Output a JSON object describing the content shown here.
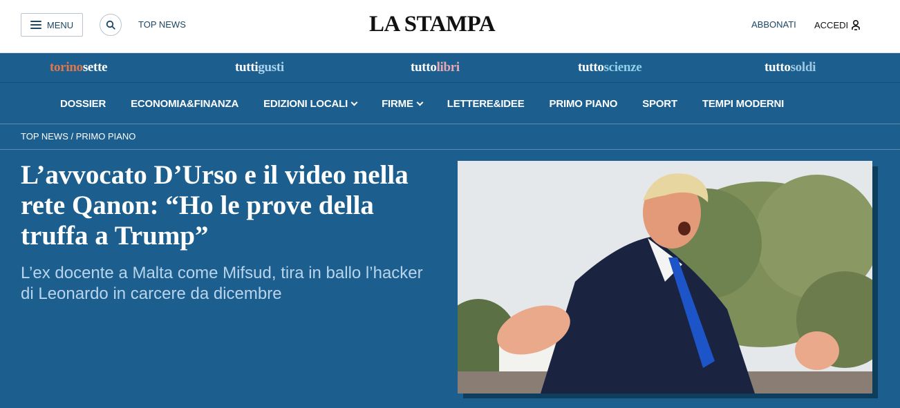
{
  "header": {
    "menu_label": "MENU",
    "top_news_link": "TOP NEWS",
    "logo": "LA STAMPA",
    "subscribe_label": "ABBONATI",
    "login_label": "ACCEDI",
    "icons": [
      "hamburger-icon",
      "search-icon",
      "user-icon"
    ]
  },
  "supplements": [
    {
      "part1": "torino",
      "part2": "sette",
      "color1": "#e0774c",
      "color2": "#ffffff"
    },
    {
      "part1": "tutti",
      "part2": "gusti",
      "color1": "#ffffff",
      "color2": "#a9d3ee"
    },
    {
      "part1": "tutto",
      "part2": "libri",
      "color1": "#ffffff",
      "color2": "#e7a7b3"
    },
    {
      "part1": "tutto",
      "part2": "scienze",
      "color1": "#ffffff",
      "color2": "#8fd0e8"
    },
    {
      "part1": "tutto",
      "part2": "soldi",
      "color1": "#ffffff",
      "color2": "#9cc8e4"
    }
  ],
  "nav": {
    "items": [
      {
        "label": "DOSSIER",
        "dropdown": false
      },
      {
        "label": "ECONOMIA&FINANZA",
        "dropdown": false
      },
      {
        "label": "EDIZIONI LOCALI",
        "dropdown": true
      },
      {
        "label": "FIRME",
        "dropdown": true
      },
      {
        "label": "LETTERE&IDEE",
        "dropdown": false
      },
      {
        "label": "PRIMO PIANO",
        "dropdown": false
      },
      {
        "label": "SPORT",
        "dropdown": false
      },
      {
        "label": "TEMPI MODERNI",
        "dropdown": false
      }
    ]
  },
  "breadcrumb": {
    "section": "TOP NEWS",
    "separator": " / ",
    "subsection": "PRIMO PIANO"
  },
  "article": {
    "headline": "L’avvocato D’Urso e il video nella rete Qanon: “Ho le prove della truffa a Trump”",
    "subheadline": "L’ex docente a Malta come Mifsud, tira in ballo l’hacker di Leonardo in carcere da dicembre"
  },
  "colors": {
    "background": "#1c5f8e",
    "header_bg": "#ffffff",
    "subhead_text": "#b8d4ec"
  }
}
